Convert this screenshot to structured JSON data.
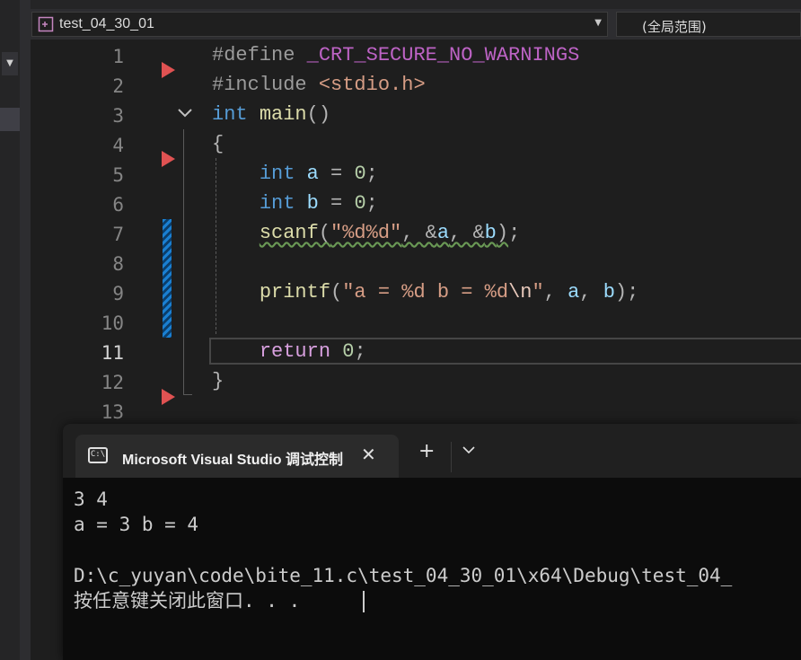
{
  "header": {
    "file_dropdown": "test_04_30_01",
    "scope_dropdown": "(全局范围)"
  },
  "editor": {
    "line_numbers": [
      "1",
      "2",
      "3",
      "4",
      "5",
      "6",
      "7",
      "8",
      "9",
      "10",
      "11",
      "12",
      "13"
    ],
    "current_line": "11"
  },
  "terminal": {
    "tab_title": "Microsoft Visual Studio 调试控制台",
    "new_tab_symbol": "+",
    "output_lines": [
      "3 4",
      "a = 3 b = 4",
      "",
      "D:\\c_yuyan\\code\\bite_11.c\\test_04_30_01\\x64\\Debug\\test_04_",
      "按任意键关闭此窗口. . ."
    ]
  },
  "colors": {
    "keyword": "#569cd6",
    "function": "#dcdcaa",
    "string": "#d69d85",
    "breakpoint_arrow": "#e05252",
    "change_bar": "#1a7fd1"
  }
}
